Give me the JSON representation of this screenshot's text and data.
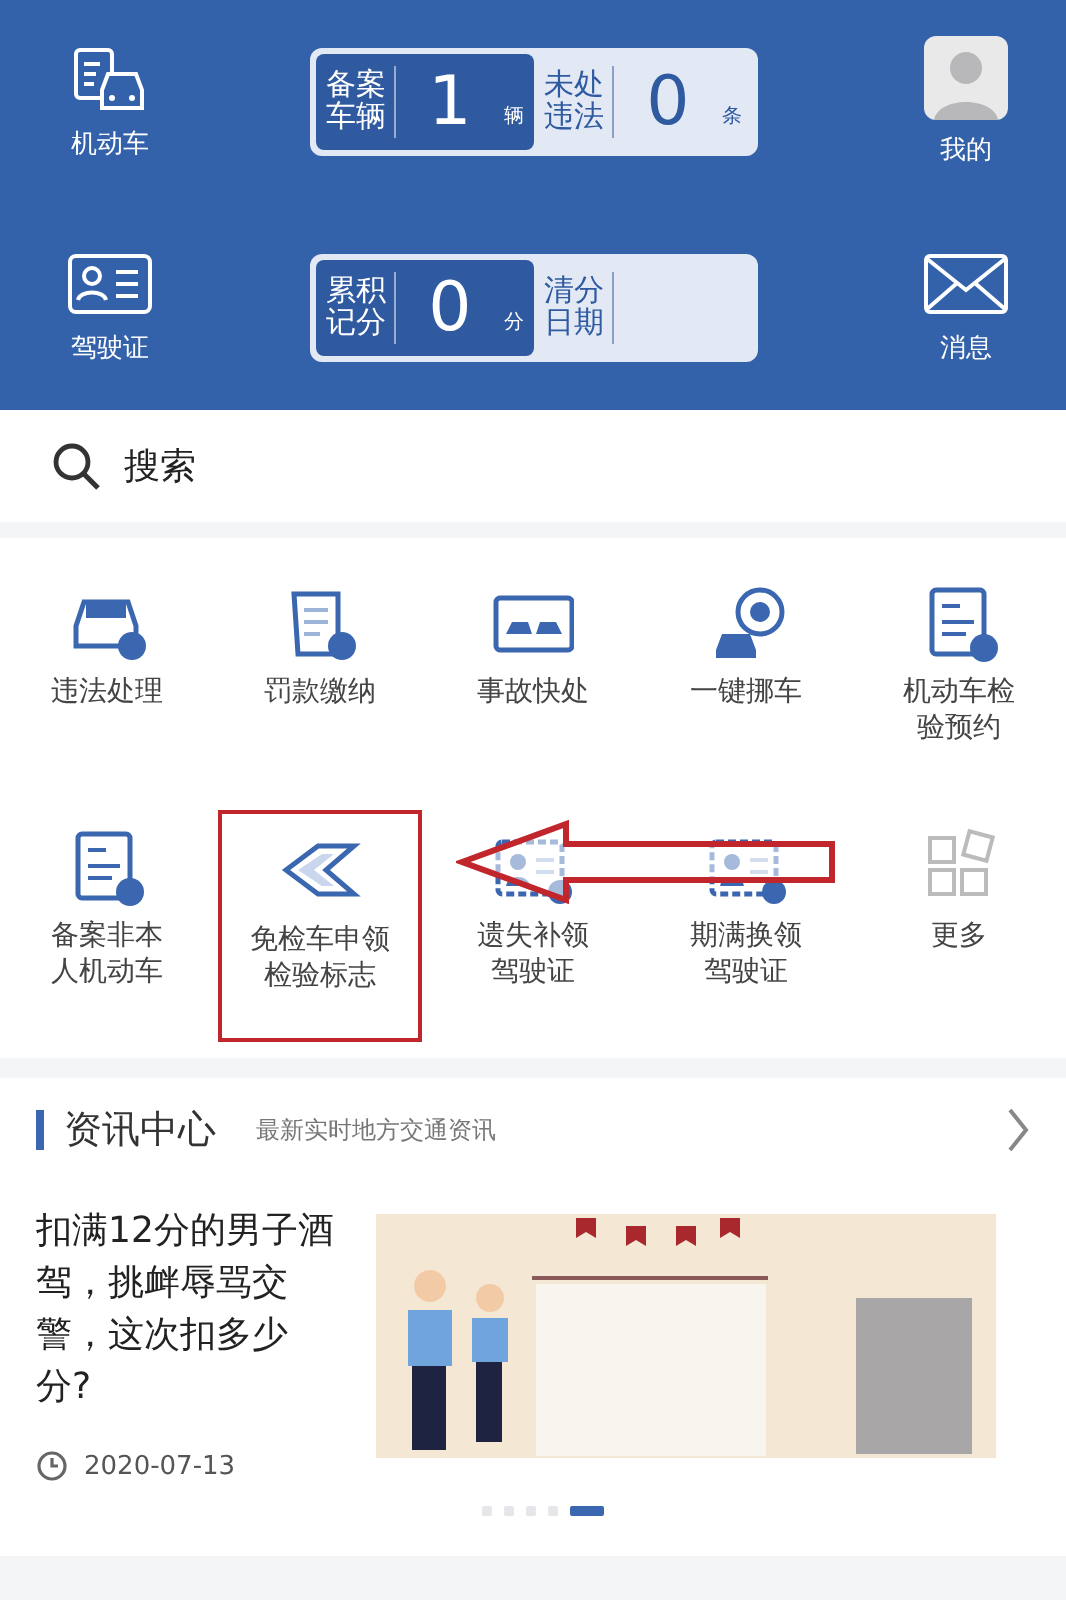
{
  "header": {
    "left_items": [
      {
        "label": "机动车",
        "kind": "car"
      },
      {
        "label": "驾驶证",
        "kind": "license"
      }
    ],
    "cards": [
      {
        "stats": [
          {
            "label": "备案车辆",
            "value": "1",
            "unit": "辆",
            "kind": "dark"
          },
          {
            "label": "未处违法",
            "value": "0",
            "unit": "条",
            "kind": "light"
          }
        ]
      },
      {
        "stats": [
          {
            "label": "累积记分",
            "value": "0",
            "unit": "分",
            "kind": "dark"
          },
          {
            "label": "清分日期",
            "kind": "light"
          }
        ]
      }
    ],
    "right_items": [
      {
        "label": "我的",
        "kind": "avatar"
      },
      {
        "label": "消息",
        "kind": "mail"
      }
    ]
  },
  "search": {
    "placeholder": "搜索"
  },
  "services": [
    {
      "label": "违法处理",
      "kind": "car",
      "highlighted": false
    },
    {
      "label": "罚款缴纳",
      "kind": "scroll",
      "highlighted": false
    },
    {
      "label": "事故快处",
      "kind": "accident",
      "highlighted": false
    },
    {
      "label": "一键挪车",
      "kind": "move",
      "highlighted": false
    },
    {
      "label": "机动车检验预约",
      "kind": "doc",
      "highlighted": false
    },
    {
      "label": "备案非本人机动车",
      "kind": "doc",
      "highlighted": false
    },
    {
      "label": "免检车申领检验标志",
      "kind": "badge",
      "highlighted": true
    },
    {
      "label": "遗失补领驾驶证",
      "kind": "card",
      "highlighted": false
    },
    {
      "label": "期满换领驾驶证",
      "kind": "card",
      "highlighted": false
    },
    {
      "label": "更多",
      "kind": "more",
      "highlighted": false
    }
  ],
  "news": {
    "title": "资讯中心",
    "subtitle": "最新实时地方交通资讯",
    "article": {
      "headline": "扣满12分的男子酒驾，挑衅辱骂交警，这次扣多少分?",
      "date": "2020-07-13",
      "kind": "picture"
    },
    "dots": [
      {
        "selected": false
      },
      {
        "selected": false
      },
      {
        "selected": false
      },
      {
        "selected": false
      },
      {
        "selected": true
      }
    ]
  }
}
